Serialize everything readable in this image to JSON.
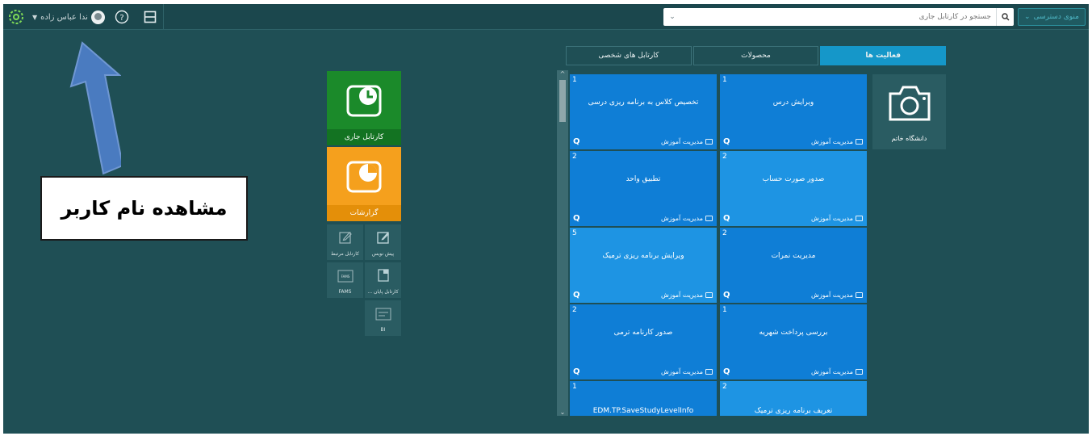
{
  "topbar": {
    "user_name": "ندا عباس زاده",
    "search_placeholder": "جستجو در کارتابل جاری",
    "access_menu_label": "منوی دسترسی",
    "icons": [
      "gear-icon",
      "avatar",
      "help-icon",
      "layout-icon",
      "search-icon",
      "chevron-down-icon"
    ]
  },
  "annotation": {
    "callout_text": "مشاهده نام کاربر"
  },
  "left_tiles": {
    "current_cartable": "کارتابل جاری",
    "reports": "گزارشات",
    "draft": "پیش نویس",
    "related_cartable": "کارتابل مرتبط",
    "finished_cartable": "کارتابل پایان ...",
    "fams": "FAMS",
    "fams_icon_text": "FAMS",
    "bi": "BI"
  },
  "tabs": [
    {
      "label": "فعالیت ها",
      "active": true
    },
    {
      "label": "محصولات",
      "active": false
    },
    {
      "label": "کارتابل های شخصی",
      "active": false
    }
  ],
  "university": {
    "label": "دانشگاه خاتم"
  },
  "cards": [
    {
      "count": "1",
      "title": "ویرایش درس",
      "dept": "مدیریت آموزش"
    },
    {
      "count": "1",
      "title": "تخصیص کلاس به برنامه ریزی درسی",
      "dept": "مدیریت آموزش"
    },
    {
      "count": "2",
      "title": "صدور صورت حساب",
      "dept": "مدیریت آموزش"
    },
    {
      "count": "2",
      "title": "تطبیق واحد",
      "dept": "مدیریت آموزش"
    },
    {
      "count": "2",
      "title": "مدیریت نمرات",
      "dept": "مدیریت آموزش"
    },
    {
      "count": "5",
      "title": "ویرایش برنامه ریزی ترمیک",
      "dept": "مدیریت آموزش"
    },
    {
      "count": "1",
      "title": "بررسی پرداخت شهریه",
      "dept": "مدیریت آموزش"
    },
    {
      "count": "2",
      "title": "صدور کارنامه ترمی",
      "dept": "مدیریت آموزش"
    },
    {
      "count": "2",
      "title": "تعریف برنامه ریزی ترمیک",
      "dept": ""
    },
    {
      "count": "1",
      "title": "EDM.TP.SaveStudyLevelInfo",
      "dept": ""
    }
  ],
  "colors": {
    "background": "#1f4f55",
    "tab_active": "#1597c9",
    "card_dark": "#0f7ed6",
    "card_light": "#1e94e3",
    "tile_green": "#1b8a2a",
    "tile_orange": "#f5a01d",
    "arrow": "#4a7bc0"
  }
}
